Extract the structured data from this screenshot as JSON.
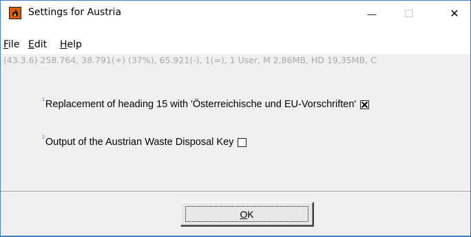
{
  "window": {
    "title": "Settings for Austria",
    "controls": {
      "minimize": "—",
      "maximize": "☐",
      "close": "✕"
    }
  },
  "menu": {
    "items": [
      {
        "accel": "F",
        "rest": "ile"
      },
      {
        "accel": "E",
        "rest": "dit"
      },
      {
        "accel": "H",
        "rest": "elp"
      }
    ]
  },
  "status_line": "(43.3.6) 258.764, 38.791(+) (37%), 65.921(-), 1(=), 1 User, M 2,86MB, HD 19,35MB, C",
  "options": [
    {
      "marker": "1",
      "label": "Replacement of heading 15 with 'Österreichische und EU-Vorschriften'",
      "checked": true
    },
    {
      "marker": "2",
      "label": "Output of the Austrian Waste Disposal Key",
      "checked": false
    }
  ],
  "buttons": {
    "ok_accel": "O",
    "ok_rest": "K"
  },
  "colors": {
    "border": "#3c80c7",
    "status_text": "#a9a9a9",
    "marker": "#3a6ad4",
    "app_icon": "#e05a00"
  },
  "icons": {
    "app": "flame-icon"
  }
}
